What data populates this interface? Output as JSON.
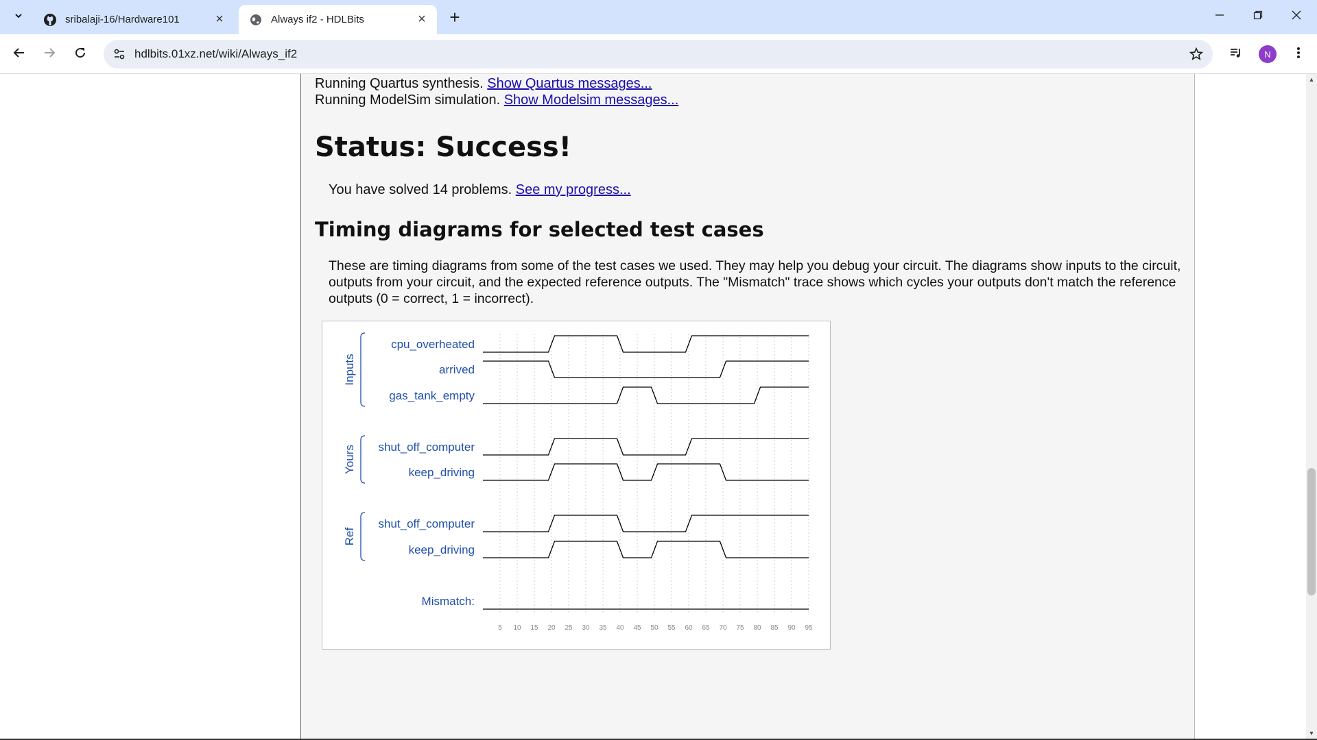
{
  "browser": {
    "tabs": [
      {
        "title": "sribalaji-16/Hardware101",
        "favicon": "github-icon",
        "active": false
      },
      {
        "title": "Always if2 - HDLBits",
        "favicon": "globe-icon",
        "active": true
      }
    ],
    "url": "hdlbits.01xz.net/wiki/Always_if2",
    "profile_initial": "N"
  },
  "page": {
    "quartus_text": "Running Quartus synthesis.",
    "quartus_link": "Show Quartus messages...",
    "modelsim_text": "Running ModelSim simulation.",
    "modelsim_link": "Show Modelsim messages...",
    "status_heading": "Status: Success!",
    "solved_text": "You have solved 14 problems.",
    "progress_link": "See my progress...",
    "timing_heading": "Timing diagrams for selected test cases",
    "timing_description": "These are timing diagrams from some of the test cases we used. They may help you debug your circuit. The diagrams show inputs to the circuit, outputs from your circuit, and the expected reference outputs. The \"Mismatch\" trace shows which cycles your outputs don't match the reference outputs (0 = correct, 1 = incorrect)."
  },
  "chart_data": {
    "type": "timing",
    "time_ticks": [
      5,
      10,
      15,
      20,
      25,
      30,
      35,
      40,
      45,
      50,
      55,
      60,
      65,
      70,
      75,
      80,
      85,
      90,
      95
    ],
    "groups": [
      {
        "label": "Inputs",
        "signals": [
          {
            "name": "cpu_overheated",
            "transitions": [
              [
                0,
                0
              ],
              [
                20,
                1
              ],
              [
                40,
                0
              ],
              [
                60,
                1
              ]
            ]
          },
          {
            "name": "arrived",
            "transitions": [
              [
                0,
                1
              ],
              [
                20,
                0
              ],
              [
                70,
                1
              ]
            ]
          },
          {
            "name": "gas_tank_empty",
            "transitions": [
              [
                0,
                0
              ],
              [
                40,
                1
              ],
              [
                50,
                0
              ],
              [
                80,
                1
              ]
            ]
          }
        ]
      },
      {
        "label": "Yours",
        "signals": [
          {
            "name": "shut_off_computer",
            "transitions": [
              [
                0,
                0
              ],
              [
                20,
                1
              ],
              [
                40,
                0
              ],
              [
                60,
                1
              ]
            ]
          },
          {
            "name": "keep_driving",
            "transitions": [
              [
                0,
                0
              ],
              [
                20,
                1
              ],
              [
                40,
                0
              ],
              [
                50,
                1
              ],
              [
                70,
                0
              ]
            ]
          }
        ]
      },
      {
        "label": "Ref",
        "signals": [
          {
            "name": "shut_off_computer",
            "transitions": [
              [
                0,
                0
              ],
              [
                20,
                1
              ],
              [
                40,
                0
              ],
              [
                60,
                1
              ]
            ]
          },
          {
            "name": "keep_driving",
            "transitions": [
              [
                0,
                0
              ],
              [
                20,
                1
              ],
              [
                40,
                0
              ],
              [
                50,
                1
              ],
              [
                70,
                0
              ]
            ]
          }
        ]
      }
    ],
    "mismatch": {
      "name": "Mismatch:",
      "transitions": [
        [
          0,
          0
        ]
      ]
    },
    "time_range": [
      0,
      95
    ],
    "colors": {
      "label": "#1f4fa8",
      "wave": "#000000",
      "grid": "#cfcfcf",
      "tick": "#888888"
    }
  }
}
